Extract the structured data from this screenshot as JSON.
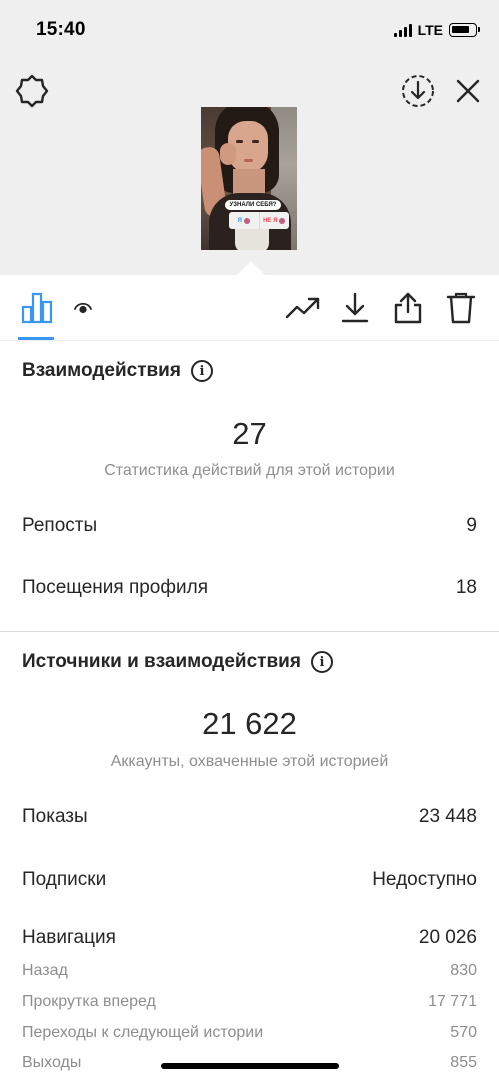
{
  "status_bar": {
    "time": "15:40",
    "network": "LTE"
  },
  "header": {
    "icons": [
      "settings-icon",
      "download-circle-icon",
      "close-icon"
    ]
  },
  "story_preview": {
    "poll_question": "УЗНАЛИ СЕБЯ?",
    "poll_option_yes": "Я",
    "poll_option_no": "НЕ Я"
  },
  "toolbar": {
    "tabs": [
      {
        "icon": "bar-chart-icon",
        "active": true
      },
      {
        "icon": "eye-icon",
        "active": false
      }
    ],
    "actions": [
      "trending-up-icon",
      "download-icon",
      "share-icon",
      "trash-icon"
    ],
    "accent_color": "#3897f0"
  },
  "interactions": {
    "title": "Взаимодействия",
    "total": "27",
    "caption": "Статистика действий для этой истории",
    "rows": [
      {
        "label": "Репосты",
        "value": "9"
      },
      {
        "label": "Посещения профиля",
        "value": "18"
      }
    ]
  },
  "discovery": {
    "title": "Источники и взаимодействия",
    "total": "21 622",
    "caption": "Аккаунты, охваченные этой историей",
    "rows": [
      {
        "label": "Показы",
        "value": "23 448"
      },
      {
        "label": "Подписки",
        "value": "Недоступно"
      },
      {
        "label": "Навигация",
        "value": "20 026"
      }
    ],
    "navigation_details": [
      {
        "label": "Назад",
        "value": "830"
      },
      {
        "label": "Прокрутка вперед",
        "value": "17 771"
      },
      {
        "label": "Переходы к следующей истории",
        "value": "570"
      },
      {
        "label": "Выходы",
        "value": "855"
      }
    ]
  }
}
